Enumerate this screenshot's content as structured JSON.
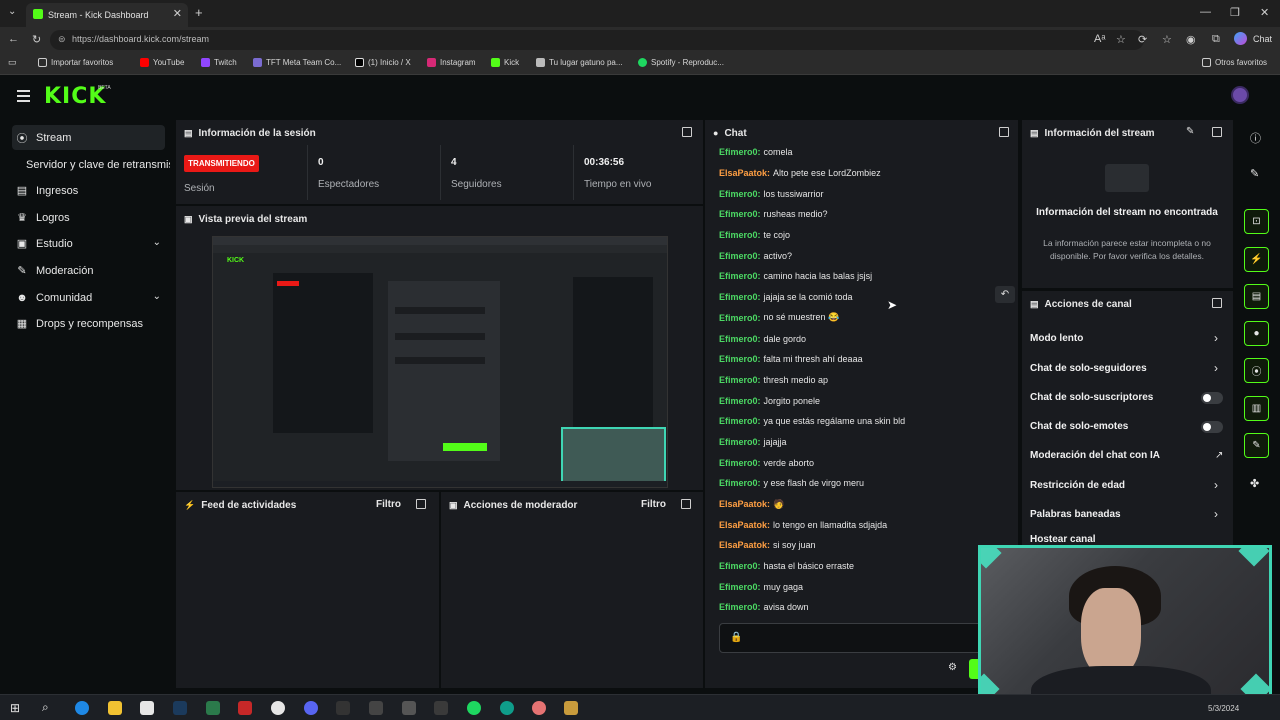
{
  "browser": {
    "tab_title": "Stream - Kick Dashboard",
    "url": "https://dashboard.kick.com/stream",
    "bookmarks": [
      "Importar favoritos",
      "YouTube",
      "Twitch",
      "TFT Meta Team Co...",
      "(1) Inicio / X",
      "Instagram",
      "Kick",
      "Tu lugar gatuno pa...",
      "Spotify - Reproduc..."
    ],
    "other_bookmarks": "Otros favoritos",
    "new_tab": "+"
  },
  "app": {
    "logo": "KICK",
    "logo_sup": "BETA"
  },
  "sidebar": {
    "items": [
      {
        "label": "Stream",
        "icon": "((·))"
      },
      {
        "label": "Servidor y clave de retransmisión",
        "icon": ""
      },
      {
        "label": "Ingresos",
        "icon": "▤"
      },
      {
        "label": "Logros",
        "icon": "🏆"
      },
      {
        "label": "Estudio",
        "icon": "▣"
      },
      {
        "label": "Moderación",
        "icon": "🔧"
      },
      {
        "label": "Comunidad",
        "icon": "👥"
      },
      {
        "label": "Drops y recompensas",
        "icon": "▦"
      }
    ]
  },
  "session": {
    "title": "Información de la sesión",
    "status": "TRANSMITIENDO",
    "session_label": "Sesión",
    "viewers_value": "0",
    "viewers_label": "Espectadores",
    "followers_value": "4",
    "followers_label": "Seguidores",
    "uptime_value": "00:36:56",
    "uptime_label": "Tiempo en vivo"
  },
  "preview": {
    "title": "Vista previa del stream"
  },
  "activity": {
    "title": "Feed de actividades",
    "filter": "Filtro"
  },
  "mod_actions": {
    "title": "Acciones de moderador",
    "filter": "Filtro"
  },
  "chat": {
    "title": "Chat",
    "messages": [
      {
        "user": "Efimero0:",
        "text": "comela",
        "color": "#4cd964"
      },
      {
        "user": "ElsaPaatok:",
        "text": "Alto pete ese LordZombiez",
        "color": "#ff9f43"
      },
      {
        "user": "Efimero0:",
        "text": "los tussiwarrior",
        "color": "#4cd964"
      },
      {
        "user": "Efimero0:",
        "text": "rusheas medio?",
        "color": "#4cd964"
      },
      {
        "user": "Efimero0:",
        "text": "te cojo",
        "color": "#4cd964"
      },
      {
        "user": "Efimero0:",
        "text": "activo?",
        "color": "#4cd964"
      },
      {
        "user": "Efimero0:",
        "text": "camino hacia las balas jsjsj",
        "color": "#4cd964"
      },
      {
        "user": "Efimero0:",
        "text": "jajaja se la comió toda",
        "color": "#4cd964"
      },
      {
        "user": "Efimero0:",
        "text": "no sé muestren 😂",
        "color": "#4cd964"
      },
      {
        "user": "Efimero0:",
        "text": "dale gordo",
        "color": "#4cd964"
      },
      {
        "user": "Efimero0:",
        "text": "falta mi thresh ahí deaaa",
        "color": "#4cd964"
      },
      {
        "user": "Efimero0:",
        "text": "thresh medio ap",
        "color": "#4cd964"
      },
      {
        "user": "Efimero0:",
        "text": "Jorgito ponele",
        "color": "#4cd964"
      },
      {
        "user": "Efimero0:",
        "text": "ya que estás regálame una skin bld",
        "color": "#4cd964"
      },
      {
        "user": "Efimero0:",
        "text": "jajajja",
        "color": "#4cd964"
      },
      {
        "user": "Efimero0:",
        "text": "verde aborto",
        "color": "#4cd964"
      },
      {
        "user": "Efimero0:",
        "text": "y ese flash de virgo meru",
        "color": "#4cd964"
      },
      {
        "user": "ElsaPaatok:",
        "text": "🧑",
        "color": "#ff9f43"
      },
      {
        "user": "ElsaPaatok:",
        "text": "lo tengo en llamadita sdjajda",
        "color": "#ff9f43"
      },
      {
        "user": "ElsaPaatok:",
        "text": "si soy juan",
        "color": "#ff9f43"
      },
      {
        "user": "Efimero0:",
        "text": "hasta el básico erraste",
        "color": "#4cd964"
      },
      {
        "user": "Efimero0:",
        "text": "muy gaga",
        "color": "#4cd964"
      },
      {
        "user": "Efimero0:",
        "text": "avisa down",
        "color": "#4cd964"
      }
    ]
  },
  "stream_info": {
    "title": "Información del stream",
    "empty_title": "Información del stream no encontrada",
    "empty_desc": "La información parece estar incompleta o no disponible. Por favor verifica los detalles."
  },
  "channel_actions": {
    "title": "Acciones de canal",
    "items": [
      {
        "label": "Modo lento",
        "control": "chevron"
      },
      {
        "label": "Chat de solo-seguidores",
        "control": "chevron"
      },
      {
        "label": "Chat de solo-suscriptores",
        "control": "toggle"
      },
      {
        "label": "Chat de solo-emotes",
        "control": "toggle"
      },
      {
        "label": "Moderación del chat con IA",
        "control": "external"
      },
      {
        "label": "Restricción de edad",
        "control": "chevron"
      },
      {
        "label": "Palabras baneadas",
        "control": "chevron"
      },
      {
        "label": "Hostear canal",
        "control": "none"
      }
    ]
  },
  "taskbar": {
    "date": "5/3/2024"
  },
  "colors": {
    "brand": "#53fc18",
    "live": "#e91916",
    "panel": "#191b1f",
    "bg": "#0b0e0f"
  }
}
